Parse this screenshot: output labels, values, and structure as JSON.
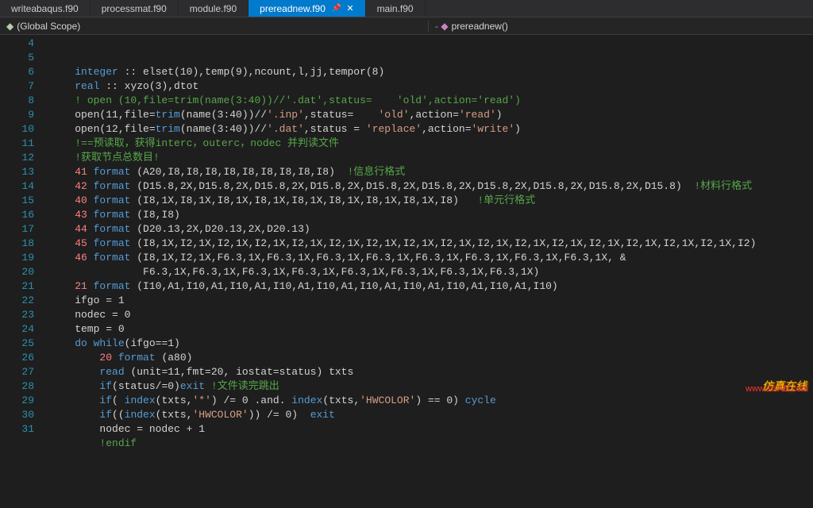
{
  "tabs": [
    {
      "label": "writeabaqus.f90",
      "active": false
    },
    {
      "label": "processmat.f90",
      "active": false
    },
    {
      "label": "module.f90",
      "active": false
    },
    {
      "label": "prereadnew.f90",
      "active": true
    },
    {
      "label": "main.f90",
      "active": false
    }
  ],
  "scope": {
    "left": "(Global Scope)",
    "right": "prereadnew()"
  },
  "lines": {
    "start": 4,
    "count": 28
  },
  "code": {
    "l4": {
      "k1": "integer",
      "rest": " :: elset(10),temp(9),ncount,l,jj,tempor(8)"
    },
    "l5": {
      "k1": "real",
      "rest": " :: xyzo(3),dtot"
    },
    "l6": {
      "cmt": "! open (10,file=trim(name(3:40))//'.dat',status=    'old',action='read')"
    },
    "l7": {
      "pre": "open(11,file=",
      "fn": "trim",
      "mid": "(name(3:40))//",
      "s1": "'.inp'",
      "m2": ",status=    ",
      "s2": "'old'",
      "m3": ",action=",
      "s3": "'read'",
      "end": ")"
    },
    "l8": {
      "pre": "open(12,file=",
      "fn": "trim",
      "mid": "(name(3:40))//",
      "s1": "'.dat'",
      "m2": ",status = ",
      "s2": "'replace'",
      "m3": ",action=",
      "s3": "'write'",
      "end": ")"
    },
    "l9": {
      "cmt": "!==预读取，获得interc，outerc，nodec 并判读文件"
    },
    "l10": {
      "cmt": "!获取节点总数目!"
    },
    "l11": {
      "num": "41",
      "kw": " format",
      "args": " (A20,I8,I8,I8,I8,I8,I8,I8,I8,I8)  ",
      "cmt": "!信息行格式"
    },
    "l12": {
      "num": "42",
      "kw": " format",
      "args": " (D15.8,2X,D15.8,2X,D15.8,2X,D15.8,2X,D15.8,2X,D15.8,2X,D15.8,2X,D15.8,2X,D15.8,2X,D15.8)  ",
      "cmt": "!材料行格式"
    },
    "l13": {
      "num": "40",
      "kw": " format",
      "args": " (I8,1X,I8,1X,I8,1X,I8,1X,I8,1X,I8,1X,I8,1X,I8,1X,I8)   ",
      "cmt": "!单元行格式"
    },
    "l14": {
      "num": "43",
      "kw": " format",
      "args": " (I8,I8)"
    },
    "l15": {
      "num": "44",
      "kw": " format",
      "args": " (D20.13,2X,D20.13,2X,D20.13)"
    },
    "l16": {
      "num": "45",
      "kw": " format",
      "args": " (I8,1X,I2,1X,I2,1X,I2,1X,I2,1X,I2,1X,I2,1X,I2,1X,I2,1X,I2,1X,I2,1X,I2,1X,I2,1X,I2,1X,I2,1X,I2,1X,I2)"
    },
    "l17": {
      "num": "46",
      "kw": " format",
      "args": " (I8,1X,I2,1X,F6.3,1X,F6.3,1X,F6.3,1X,F6.3,1X,F6.3,1X,F6.3,1X,F6.3,1X,F6.3,1X, &"
    },
    "l18": {
      "args": "           F6.3,1X,F6.3,1X,F6.3,1X,F6.3,1X,F6.3,1X,F6.3,1X,F6.3,1X,F6.3,1X)"
    },
    "l19": {
      "num": "21",
      "kw": " format",
      "args": " (I10,A1,I10,A1,I10,A1,I10,A1,I10,A1,I10,A1,I10,A1,I10,A1,I10,A1,I10)"
    },
    "l20": {
      "txt": "ifgo = 1"
    },
    "l21": {
      "txt": "nodec = 0"
    },
    "l22": {
      "txt": "temp = 0"
    },
    "l23": {
      "k1": "do while",
      "rest": "(ifgo==1)"
    },
    "l24": {
      "indent": "    ",
      "num": "20",
      "kw": " format",
      "args": " (a80)"
    },
    "l25": {
      "indent": "    ",
      "k1": "read",
      "rest": " (unit=11,fmt=20, iostat=status) txts"
    },
    "l26": {
      "indent": "    ",
      "k1": "if",
      "mid": "(status/=0)",
      "k2": "exit",
      "sp": " ",
      "cmt": "!文件读完跳出"
    },
    "l27": {
      "indent": "    ",
      "k1": "if",
      "p1": "( ",
      "fn1": "index",
      "a1": "(txts,",
      "s1": "'*'",
      "a2": ") /= 0 .and. ",
      "fn2": "index",
      "a3": "(txts,",
      "s2": "'HWCOLOR'",
      "a4": ") == 0) ",
      "k2": "cycle"
    },
    "l28": {
      "indent": "    ",
      "k1": "if",
      "p1": "((",
      "fn1": "index",
      "a1": "(txts,",
      "s1": "'HWCOLOR'",
      "a2": ")) /= 0)  ",
      "k2": "exit"
    },
    "l29": {
      "indent": "    ",
      "txt": "nodec = nodec + 1"
    },
    "l30": {
      "indent": "    ",
      "cmt": "!endif"
    }
  },
  "watermark": {
    "top": "仿真在线",
    "bottom": "www.1CAE.com"
  }
}
